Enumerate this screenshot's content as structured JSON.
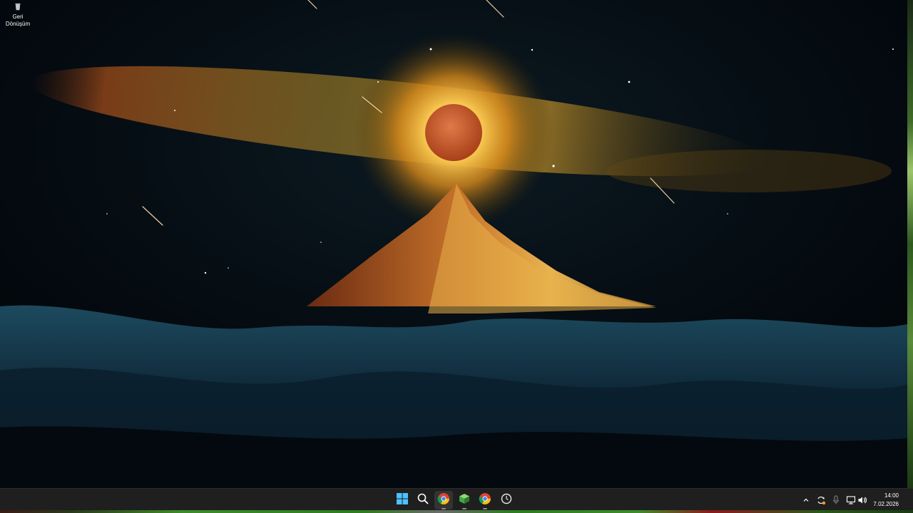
{
  "desktop": {
    "icons": [
      {
        "label_line1": "Geri",
        "label_line2": "Dönüşüm",
        "icon": "recycle-bin-icon"
      }
    ]
  },
  "taskbar": {
    "pinned": [
      {
        "name": "start-button",
        "icon": "windows-logo-icon"
      },
      {
        "name": "search-button",
        "icon": "search-icon"
      },
      {
        "name": "chrome-app",
        "icon": "chrome-icon",
        "active": true
      },
      {
        "name": "app-green-cube",
        "icon": "cube-icon"
      },
      {
        "name": "chrome-app-2",
        "icon": "chrome-icon"
      },
      {
        "name": "app-circle",
        "icon": "circle-clock-icon"
      }
    ],
    "tray": {
      "icons": [
        "chevron-up-icon",
        "sync-icon",
        "microphone-icon",
        "network-icon",
        "speaker-icon"
      ]
    },
    "clock": {
      "time": "14:00",
      "date": "7.02.2026"
    }
  },
  "colors": {
    "taskbar_bg": "#1f1f1f",
    "accent_blue": "#4cc2ff"
  }
}
